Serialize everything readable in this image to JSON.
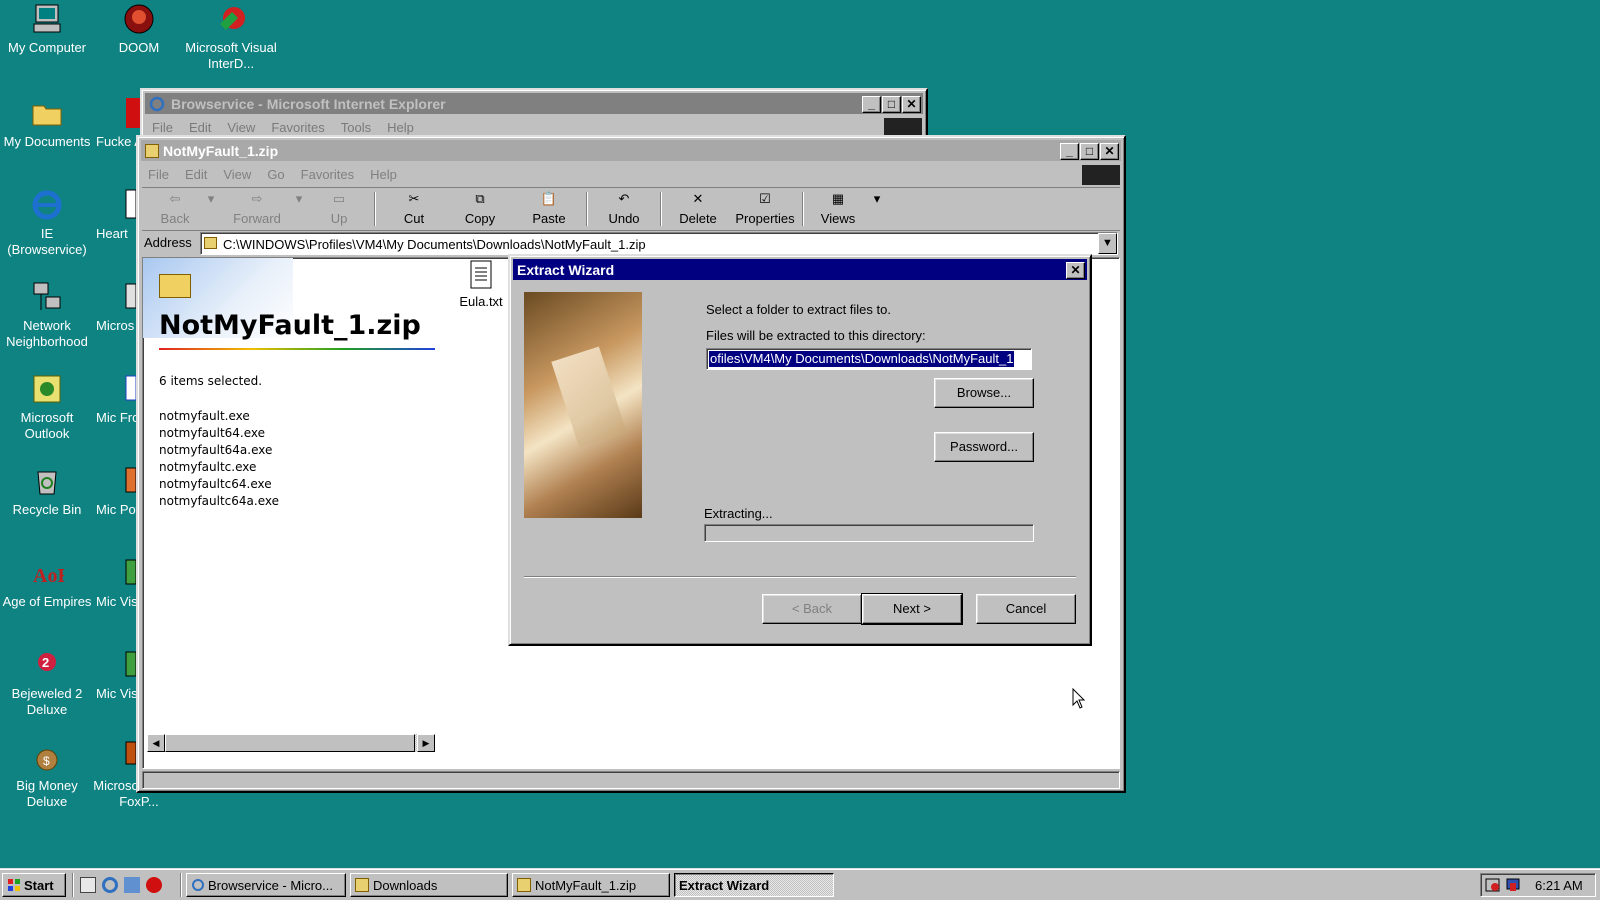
{
  "desktop": {
    "icons": [
      {
        "label": "My Computer"
      },
      {
        "label": "DOOM"
      },
      {
        "label": "Microsoft Visual InterD..."
      },
      {
        "label": "My Documents"
      },
      {
        "label": "Fucke Antivi"
      },
      {
        "label": "IE (Browservice)"
      },
      {
        "label": "Heart"
      },
      {
        "label": "Network Neighborhood"
      },
      {
        "label": "Micros"
      },
      {
        "label": "Microsoft Outlook"
      },
      {
        "label": "Mic Fron"
      },
      {
        "label": "Recycle Bin"
      },
      {
        "label": "Mic Powe"
      },
      {
        "label": "Age of Empires"
      },
      {
        "label": "Mic Visua"
      },
      {
        "label": "Bejeweled 2 Deluxe"
      },
      {
        "label": "Mic Visua"
      },
      {
        "label": "Big Money Deluxe"
      },
      {
        "label": "Microsoft Visual FoxP..."
      }
    ]
  },
  "ie_window": {
    "title": "Browservice - Microsoft Internet Explorer",
    "menu": [
      "File",
      "Edit",
      "View",
      "Favorites",
      "Tools",
      "Help"
    ]
  },
  "explorer": {
    "title": "NotMyFault_1.zip",
    "menu": [
      "File",
      "Edit",
      "View",
      "Go",
      "Favorites",
      "Help"
    ],
    "toolbar": {
      "back": "Back",
      "forward": "Forward",
      "up": "Up",
      "cut": "Cut",
      "copy": "Copy",
      "paste": "Paste",
      "undo": "Undo",
      "delete": "Delete",
      "properties": "Properties",
      "views": "Views"
    },
    "address_label": "Address",
    "address_value": "C:\\WINDOWS\\Profiles\\VM4\\My Documents\\Downloads\\NotMyFault_1.zip",
    "panel_title": "NotMyFault_1.zip",
    "selection_text": "6 items selected.",
    "files": [
      "notmyfault.exe",
      "notmyfault64.exe",
      "notmyfault64a.exe",
      "notmyfaultc.exe",
      "notmyfaultc64.exe",
      "notmyfaultc64a.exe"
    ],
    "file_icon_label": "Eula.txt"
  },
  "wizard": {
    "title": "Extract Wizard",
    "select_text": "Select a folder to extract files to.",
    "dir_text": "Files will be extracted to this directory:",
    "path_value": "ofiles\\VM4\\My Documents\\Downloads\\NotMyFault_1",
    "browse": "Browse...",
    "password": "Password...",
    "extracting": "Extracting...",
    "progress": 0,
    "back": "< Back",
    "next": "Next >",
    "cancel": "Cancel"
  },
  "taskbar": {
    "start": "Start",
    "tasks": [
      "Browservice - Micro...",
      "Downloads",
      "NotMyFault_1.zip",
      "Extract Wizard"
    ],
    "clock": "6:21 AM"
  }
}
